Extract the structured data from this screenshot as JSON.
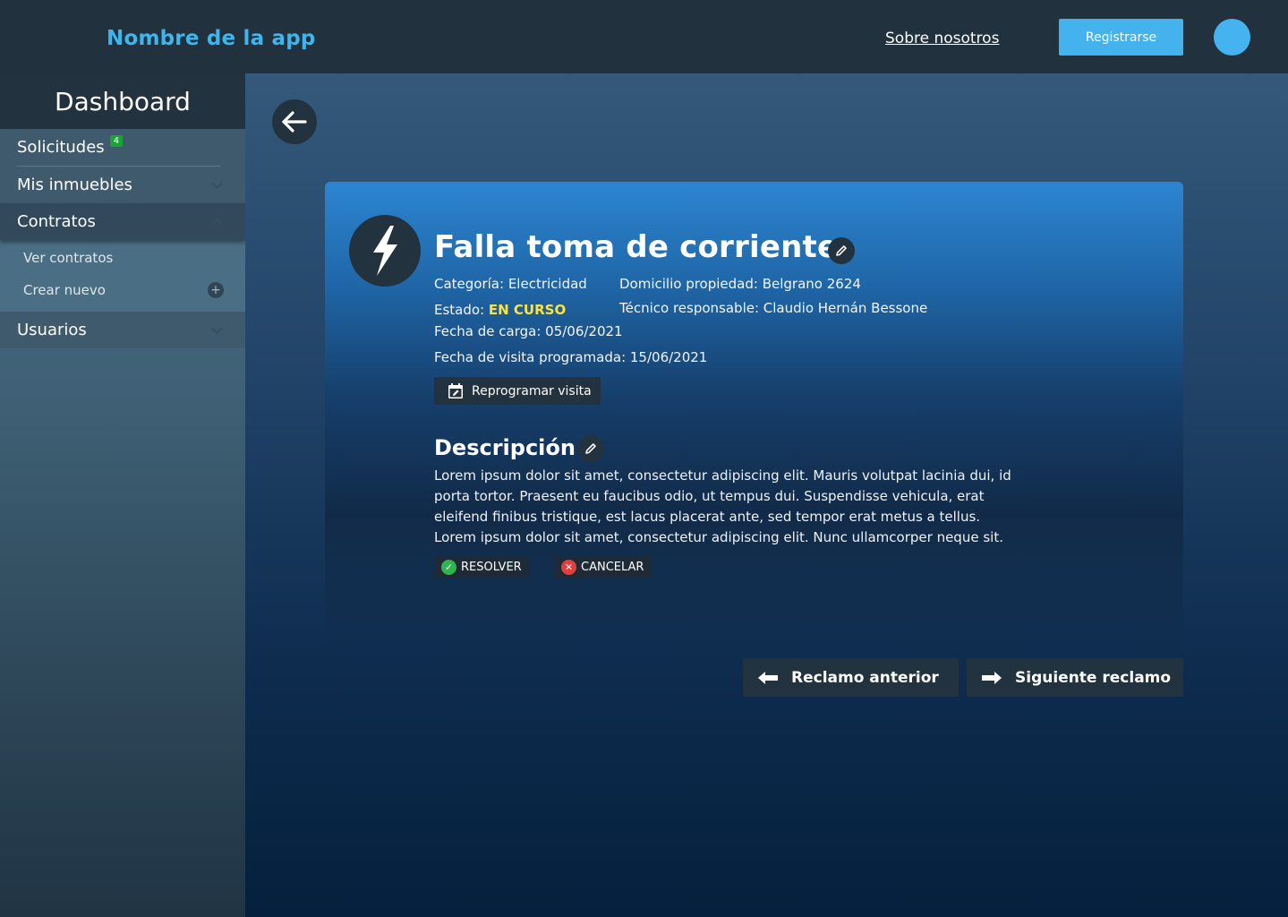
{
  "header": {
    "app_name": "Nombre de la app",
    "about_link": "Sobre nosotros",
    "register_label": "Registrarse",
    "avatar_color": "#44b3ef"
  },
  "sidebar": {
    "title": "Dashboard",
    "items": [
      {
        "label": "Solicitudes",
        "badge": "4"
      },
      {
        "label": "Mis inmuebles",
        "icon": "chevron-down-icon"
      },
      {
        "label": "Contratos",
        "icon": "chevron-up-icon",
        "expanded": true,
        "subitems": [
          {
            "label": "Ver contratos"
          },
          {
            "label": "Crear nuevo",
            "icon": "plus-circle-icon"
          }
        ]
      },
      {
        "label": "Usuarios",
        "icon": "chevron-down-icon"
      }
    ]
  },
  "claim": {
    "icon": "lightning-icon",
    "title": "Falla toma de corriente",
    "category": "Categoría: Electricidad",
    "estado_label": "Estado:",
    "estado_value": "EN CURSO",
    "estado_color": "#ffe33c",
    "fecha_carga": "Fecha de carga: 05/06/2021",
    "fecha_visita": "Fecha de visita programada: 15/06/2021",
    "domicilio": "Domicilio propiedad: Belgrano 2624",
    "tecnico": "Técnico responsable: Claudio Hernán Bessone",
    "reschedule_label": "Reprogramar visita",
    "description_title": "Descripción",
    "description": "Lorem ipsum dolor sit amet, consectetur adipiscing elit. Mauris volutpat lacinia dui, id porta tortor. Praesent eu faucibus odio, ut tempus dui. Suspendisse vehicula, erat eleifend finibus tristique, est lacus placerat ante, sed tempor erat metus a tellus. Lorem ipsum dolor sit amet, consectetur adipiscing elit. Nunc ullamcorper neque sit.",
    "resolve_label": "RESOLVER",
    "cancel_label": "CANCELAR"
  },
  "navigation": {
    "prev_label": "Reclamo anterior",
    "next_label": "Siguiente reclamo"
  }
}
